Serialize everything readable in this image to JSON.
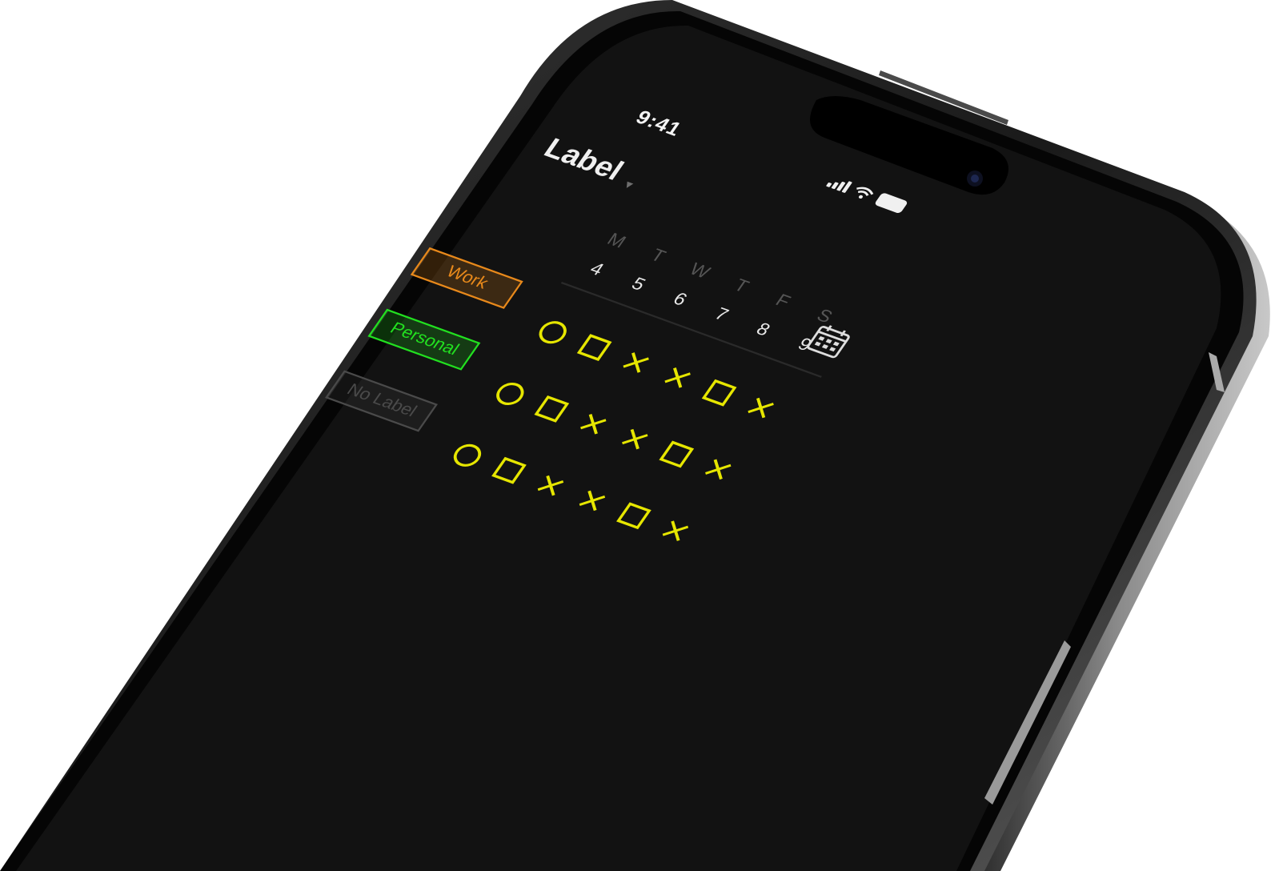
{
  "status_bar": {
    "time": "9:41",
    "signal_icon": "cellular-signal-icon",
    "wifi_icon": "wifi-icon",
    "battery_icon": "battery-icon"
  },
  "header": {
    "title": "Label",
    "dropdown_icon": "chevron-down-icon"
  },
  "calendar_button_icon": "calendar-icon",
  "week": [
    {
      "letter": "M",
      "date": "4"
    },
    {
      "letter": "T",
      "date": "5"
    },
    {
      "letter": "W",
      "date": "6"
    },
    {
      "letter": "T",
      "date": "7"
    },
    {
      "letter": "F",
      "date": "8"
    },
    {
      "letter": "S",
      "date": "9"
    }
  ],
  "labels": [
    {
      "text": "Work",
      "color": "#e8891b"
    },
    {
      "text": "Personal",
      "color": "#22e020"
    },
    {
      "text": "No Label",
      "color": "#4a4a4a"
    }
  ],
  "grid": {
    "mark_color": "#e6e600",
    "rows": [
      [
        "circle",
        "square",
        "cross",
        "cross",
        "square",
        "cross"
      ],
      [
        "circle",
        "square",
        "cross",
        "cross",
        "square",
        "cross"
      ],
      [
        "circle",
        "square",
        "cross",
        "cross",
        "square",
        "cross"
      ]
    ]
  }
}
